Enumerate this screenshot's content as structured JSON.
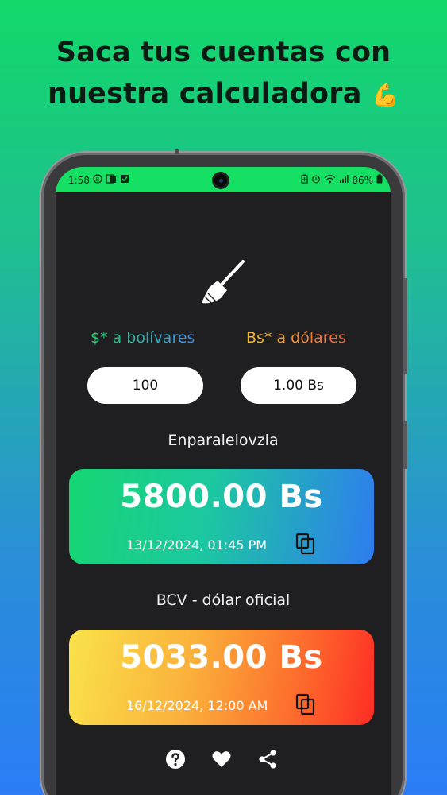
{
  "headline": {
    "line1": "Saca tus cuentas con",
    "line2": "nuestra calculadora",
    "emoji": "💪"
  },
  "status_bar": {
    "time": "1:58",
    "battery": "86%",
    "left_icons": [
      "b-icon",
      "file-icon",
      "checkbox-icon"
    ],
    "right_icons": [
      "battery-saver-icon",
      "alarm-icon",
      "wifi-icon",
      "signal-icon",
      "battery-icon"
    ]
  },
  "converter": {
    "clear_icon": "broom-icon",
    "left_label": "$* a bolívares",
    "right_label": "Bs* a dólares",
    "left_value": "100",
    "right_value": "1.00 Bs"
  },
  "rates": [
    {
      "source": "Enparalelovzla",
      "value": "5800.00 Bs",
      "date": "13/12/2024, 01:45 PM",
      "copy_icon": "copy-icon"
    },
    {
      "source": "BCV - dólar oficial",
      "value": "5033.00 Bs",
      "date": "16/12/2024, 12:00 AM",
      "copy_icon": "copy-icon"
    }
  ],
  "bottom_actions": [
    "help-icon",
    "heart-icon",
    "share-icon"
  ],
  "colors": {
    "status_bar": "#16e063",
    "screen_bg": "#1f1f21",
    "accent_green": "#16d672",
    "accent_blue": "#2f7cf0",
    "accent_yellow": "#f9e34a",
    "accent_red": "#ff2c25"
  }
}
